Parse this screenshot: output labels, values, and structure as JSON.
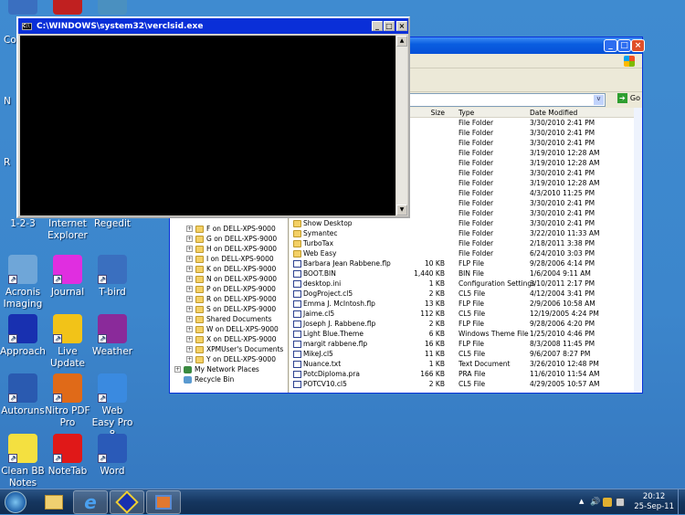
{
  "desktop": {
    "partial_top_icons": [
      "partial-icon-1",
      "partial-icon-2",
      "partial-icon-3"
    ],
    "partial_labels": [
      "Co",
      "N",
      "R"
    ],
    "icons": [
      {
        "label": "1-2-3",
        "icon": "lotus-123-icon",
        "color": "#2b5ea8"
      },
      {
        "label": "Internet Explorer",
        "icon": "internet-explorer-icon",
        "color": "#3a7fd5"
      },
      {
        "label": "Regedit",
        "icon": "regedit-icon",
        "color": "#2f6fb8"
      },
      {
        "label": "Acronis Imaging",
        "icon": "acronis-icon",
        "color": "#6fa6d8"
      },
      {
        "label": "Journal",
        "icon": "journal-key-icon",
        "color": "#e02ee0"
      },
      {
        "label": "T-bird",
        "icon": "thunderbird-icon",
        "color": "#3a6fbf"
      },
      {
        "label": "Approach",
        "icon": "approach-icon",
        "color": "#1830b0"
      },
      {
        "label": "Live Update",
        "icon": "live-update-icon",
        "color": "#f2c318"
      },
      {
        "label": "Weather",
        "icon": "weather-umbrella-icon",
        "color": "#8a2a9a"
      },
      {
        "label": "Autoruns",
        "icon": "autoruns-icon",
        "color": "#2a5ab0"
      },
      {
        "label": "Nitro PDF Pro",
        "icon": "nitro-pdf-icon",
        "color": "#e06a18"
      },
      {
        "label": "Web Easy Pro 8",
        "icon": "web-easy-icon",
        "color": "#3a8ae0"
      },
      {
        "label": "Clean BB Notes",
        "icon": "clean-bb-notes-icon",
        "color": "#f4e040"
      },
      {
        "label": "NoteTab",
        "icon": "notetab-icon",
        "color": "#e01818"
      },
      {
        "label": "Word",
        "icon": "word-icon",
        "color": "#2a5ab8"
      }
    ]
  },
  "console": {
    "title": "C:\\WINDOWS\\system32\\verclsid.exe",
    "minimize": "_",
    "maximize": "□",
    "close": "×"
  },
  "explorer": {
    "address": {
      "go_label": "Go"
    },
    "columns": {
      "size": "Size",
      "type": "Type",
      "date": "Date Modified"
    },
    "tree": [
      "F on DELL-XPS-9000",
      "G on DELL-XPS-9000",
      "H on DELL-XPS-9000",
      "I on DELL-XPS-9000",
      "K on DELL-XPS-9000",
      "N on DELL-XPS-9000",
      "P on DELL-XPS-9000",
      "R on DELL-XPS-9000",
      "S on DELL-XPS-9000",
      "Shared Documents",
      "W on DELL-XPS-9000",
      "X on DELL-XPS-9000",
      "XPMUser's Documents",
      "Y on DELL-XPS-9000"
    ],
    "tree_bottom": [
      "My Network Places",
      "Recycle Bin"
    ],
    "files": [
      {
        "name": "",
        "size": "",
        "type": "File Folder",
        "date": "3/30/2010 2:41 PM",
        "folder": true
      },
      {
        "name": "",
        "size": "",
        "type": "File Folder",
        "date": "3/30/2010 2:41 PM",
        "folder": true
      },
      {
        "name": "",
        "size": "",
        "type": "File Folder",
        "date": "3/30/2010 2:41 PM",
        "folder": true
      },
      {
        "name": "",
        "size": "",
        "type": "File Folder",
        "date": "3/19/2010 12:28 AM",
        "folder": true
      },
      {
        "name": "",
        "size": "",
        "type": "File Folder",
        "date": "3/19/2010 12:28 AM",
        "folder": true
      },
      {
        "name": "",
        "size": "",
        "type": "File Folder",
        "date": "3/30/2010 2:41 PM",
        "folder": true
      },
      {
        "name": "",
        "size": "",
        "type": "File Folder",
        "date": "3/19/2010 12:28 AM",
        "folder": true
      },
      {
        "name": "",
        "size": "",
        "type": "File Folder",
        "date": "4/3/2010 11:25 PM",
        "folder": true
      },
      {
        "name": "",
        "size": "",
        "type": "File Folder",
        "date": "3/30/2010 2:41 PM",
        "folder": true
      },
      {
        "name": "",
        "size": "",
        "type": "File Folder",
        "date": "3/30/2010 2:41 PM",
        "folder": true
      },
      {
        "name": "Show Desktop",
        "size": "",
        "type": "File Folder",
        "date": "3/30/2010 2:41 PM",
        "folder": true
      },
      {
        "name": "Symantec",
        "size": "",
        "type": "File Folder",
        "date": "3/22/2010 11:33 AM",
        "folder": true
      },
      {
        "name": "TurboTax",
        "size": "",
        "type": "File Folder",
        "date": "2/18/2011 3:38 PM",
        "folder": true
      },
      {
        "name": "Web Easy",
        "size": "",
        "type": "File Folder",
        "date": "6/24/2010 3:03 PM",
        "folder": true
      },
      {
        "name": "Barbara Jean Rabbene.flp",
        "size": "10 KB",
        "type": "FLP File",
        "date": "9/28/2006 4:14 PM"
      },
      {
        "name": "BOOT.BIN",
        "size": "1,440 KB",
        "type": "BIN File",
        "date": "1/6/2004 9:11 AM"
      },
      {
        "name": "desktop.ini",
        "size": "1 KB",
        "type": "Configuration Settings",
        "date": "3/10/2011 2:17 PM"
      },
      {
        "name": "DogProject.cl5",
        "size": "2 KB",
        "type": "CL5 File",
        "date": "4/12/2004 3:41 PM"
      },
      {
        "name": "Emma J. McIntosh.flp",
        "size": "13 KB",
        "type": "FLP File",
        "date": "2/9/2006 10:58 AM"
      },
      {
        "name": "Jaime.cl5",
        "size": "112 KB",
        "type": "CL5 File",
        "date": "12/19/2005 4:24 PM"
      },
      {
        "name": "Joseph J. Rabbene.flp",
        "size": "2 KB",
        "type": "FLP File",
        "date": "9/28/2006 4:20 PM"
      },
      {
        "name": "Light Blue.Theme",
        "size": "6 KB",
        "type": "Windows Theme File",
        "date": "1/25/2010 4:46 PM"
      },
      {
        "name": "margit rabbene.flp",
        "size": "16 KB",
        "type": "FLP File",
        "date": "8/3/2008 11:45 PM"
      },
      {
        "name": "MikeJ.cl5",
        "size": "11 KB",
        "type": "CL5 File",
        "date": "9/6/2007 8:27 PM"
      },
      {
        "name": "Nuance.txt",
        "size": "1 KB",
        "type": "Text Document",
        "date": "3/26/2010 12:48 PM"
      },
      {
        "name": "PotcDiploma.pra",
        "size": "166 KB",
        "type": "PRA File",
        "date": "11/6/2010 11:54 AM"
      },
      {
        "name": "POTCV10.cl5",
        "size": "2 KB",
        "type": "CL5 File",
        "date": "4/29/2005 10:57 AM"
      }
    ]
  },
  "taskbar": {
    "buttons": [
      "start-orb",
      "windows-explorer",
      "internet-explorer",
      "approach",
      "verclsid-task"
    ],
    "clock": {
      "time": "20:12",
      "date": "25-Sep-11"
    }
  }
}
